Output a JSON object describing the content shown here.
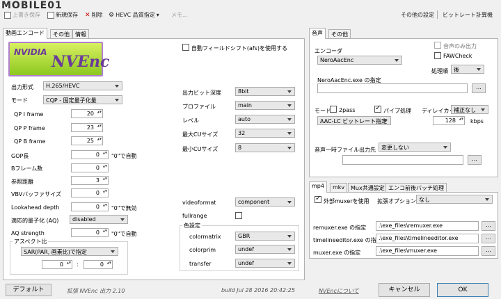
{
  "watermark": "MOBILE01",
  "toolbar": {
    "save_default": "上書き保存",
    "save_new": "新規保存",
    "delete": "削除",
    "hevc": "HEVC 品質指定",
    "memo": "メモ...",
    "other_settings": "その他の設定",
    "bitrate_calc": "ビットレート計算機"
  },
  "left_tabs": [
    "動画エンコード",
    "その他",
    "情報"
  ],
  "logo": {
    "nvidia": "NVIDIA",
    "nvenc": "NVEnc"
  },
  "video": {
    "output_format_label": "出力形式",
    "output_format": "H.265/HEVC",
    "mode_label": "モード",
    "mode": "CQP - 固定量子化量",
    "qpi_label": "QP I frame",
    "qpi": "20",
    "qpp_label": "QP P frame",
    "qpp": "23",
    "qpb_label": "QP B frame",
    "qpb": "25",
    "gop_label": "GOP長",
    "gop": "0",
    "gop_note": "\"0\"で自動",
    "bframes_label": "Bフレーム数",
    "bframes": "0",
    "ref_label": "参照距離",
    "ref": "3",
    "vbv_label": "VBVバッファサイズ",
    "vbv": "0",
    "lookahead_label": "Lookahead depth",
    "lookahead": "0",
    "lookahead_note": "\"0\"で無効",
    "aq_label": "適応的量子化 (AQ)",
    "aq": "disabled",
    "aqs_label": "AQ strength",
    "aqs": "0",
    "aqs_note": "\"0\"で自動",
    "aspect_group": "アスペクト比",
    "aspect_mode": "SAR(PAR, 画素比)で指定",
    "aspect_w": "0",
    "aspect_sep": ":",
    "aspect_h": "0",
    "afs_label": "自動フィールドシフト(afs)を使用する",
    "bitdepth_label": "出力ビット深度",
    "bitdepth": "8bit",
    "profile_label": "プロファイル",
    "profile": "main",
    "level_label": "レベル",
    "level": "auto",
    "maxcu_label": "最大CUサイズ",
    "maxcu": "32",
    "mincu_label": "最小CUサイズ",
    "mincu": "8",
    "videoformat_label": "videoformat",
    "videoformat": "component",
    "fullrange_label": "fullrange",
    "color_group": "色設定",
    "colormatrix_label": "colormatrix",
    "colormatrix": "GBR",
    "colorprim_label": "colorprim",
    "colorprim": "undef",
    "transfer_label": "transfer",
    "transfer": "undef"
  },
  "audio_tabs": [
    "音声",
    "その他"
  ],
  "audio": {
    "encoder_label": "エンコーダ",
    "encoder": "NeroAacEnc",
    "audio_only_label": "音声のみ出力",
    "fawcheck_label": "FAWCheck",
    "order_label": "処理順",
    "order": "後",
    "exe_label": "NeroAacEnc.exe の指定",
    "exe_value": "",
    "browse": "...",
    "mode_label": "モード",
    "twopass_label": "2pass",
    "pipe_label": "パイプ処理",
    "delay_label": "ディレイカット",
    "delay": "補正なし",
    "mode_value": "AAC-LC ビットレート指定",
    "bitrate": "128",
    "kbps": "kbps",
    "temp_label": "音声一時ファイル出力先",
    "temp_value": "変更しない",
    "temp_path": ""
  },
  "mux_tabs": [
    "mp4",
    "mkv",
    "Mux共通設定",
    "エンコ前後バッチ処理"
  ],
  "mux": {
    "external_label": "外部muxerを使用",
    "ext_opt_label": "拡張オプション",
    "ext_opt": "なし",
    "remuxer_label": "remuxer.exe の指定",
    "remuxer": ".\\exe_files\\remuxer.exe",
    "tle_label": "timelineeditor.exe の指定",
    "tle": ".\\exe_files\\timelineeditor.exe",
    "muxer_label": "muxer.exe の指定",
    "muxer": ".\\exe_files\\muxer.exe"
  },
  "footer": {
    "default": "デフォルト",
    "version": "拡張 NVEnc 出力 2.10",
    "build": "build Jul 28 2016 20:42:25",
    "about": "NVEncについて",
    "cancel": "キャンセル",
    "ok": "OK"
  }
}
